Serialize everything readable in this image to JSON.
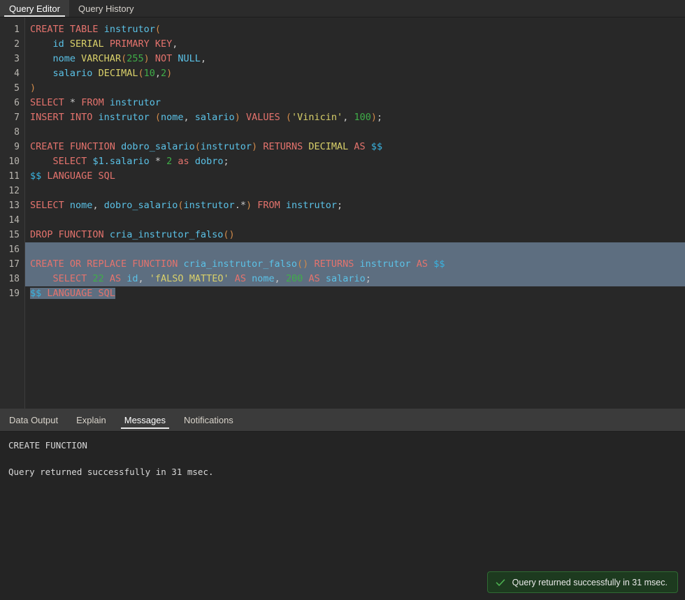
{
  "editor_tabs": [
    {
      "label": "Query Editor",
      "active": true
    },
    {
      "label": "Query History",
      "active": false
    }
  ],
  "code": {
    "lines": [
      {
        "n": "1",
        "selected": "none"
      },
      {
        "n": "2",
        "selected": "none"
      },
      {
        "n": "3",
        "selected": "none"
      },
      {
        "n": "4",
        "selected": "none"
      },
      {
        "n": "5",
        "selected": "none"
      },
      {
        "n": "6",
        "selected": "none"
      },
      {
        "n": "7",
        "selected": "none"
      },
      {
        "n": "8",
        "selected": "none"
      },
      {
        "n": "9",
        "selected": "none"
      },
      {
        "n": "10",
        "selected": "none"
      },
      {
        "n": "11",
        "selected": "none"
      },
      {
        "n": "12",
        "selected": "none"
      },
      {
        "n": "13",
        "selected": "none"
      },
      {
        "n": "14",
        "selected": "none"
      },
      {
        "n": "15",
        "selected": "none"
      },
      {
        "n": "16",
        "selected": "full"
      },
      {
        "n": "17",
        "selected": "full"
      },
      {
        "n": "18",
        "selected": "full"
      },
      {
        "n": "19",
        "selected": "partial"
      }
    ],
    "text": [
      "CREATE TABLE instrutor(",
      "    id SERIAL PRIMARY KEY,",
      "    nome VARCHAR(255) NOT NULL,",
      "    salario DECIMAL(10,2)",
      ")",
      "SELECT * FROM instrutor",
      "INSERT INTO instrutor (nome, salario) VALUES ('Vinicin', 100);",
      "",
      "CREATE FUNCTION dobro_salario(instrutor) RETURNS DECIMAL AS $$",
      "    SELECT $1.salario * 2 as dobro;",
      "$$ LANGUAGE SQL",
      "",
      "SELECT nome, dobro_salario(instrutor.*) FROM instrutor;",
      "",
      "DROP FUNCTION cria_instrutor_falso()",
      "",
      "CREATE OR REPLACE FUNCTION cria_instrutor_falso() RETURNS instrutor AS $$",
      "    SELECT 22 AS id, 'fALSO MATTEO' AS nome, 200 AS salario;",
      "$$ LANGUAGE SQL"
    ]
  },
  "output_tabs": [
    {
      "label": "Data Output",
      "active": false
    },
    {
      "label": "Explain",
      "active": false
    },
    {
      "label": "Messages",
      "active": true
    },
    {
      "label": "Notifications",
      "active": false
    }
  ],
  "messages": {
    "line1": "CREATE FUNCTION",
    "line2": "Query returned successfully in 31 msec."
  },
  "toast": {
    "icon": "check-icon",
    "text": "Query returned successfully in 31 msec."
  },
  "colors": {
    "keyword": "#e4736d",
    "type": "#d9d06a",
    "identifier": "#5bc2e7",
    "number": "#3fae48",
    "string": "#d9d06a",
    "selection": "#5d6e80",
    "toast_bg": "#1d3a1f",
    "toast_border": "#2f6b33",
    "toast_accent": "#4caf50"
  }
}
